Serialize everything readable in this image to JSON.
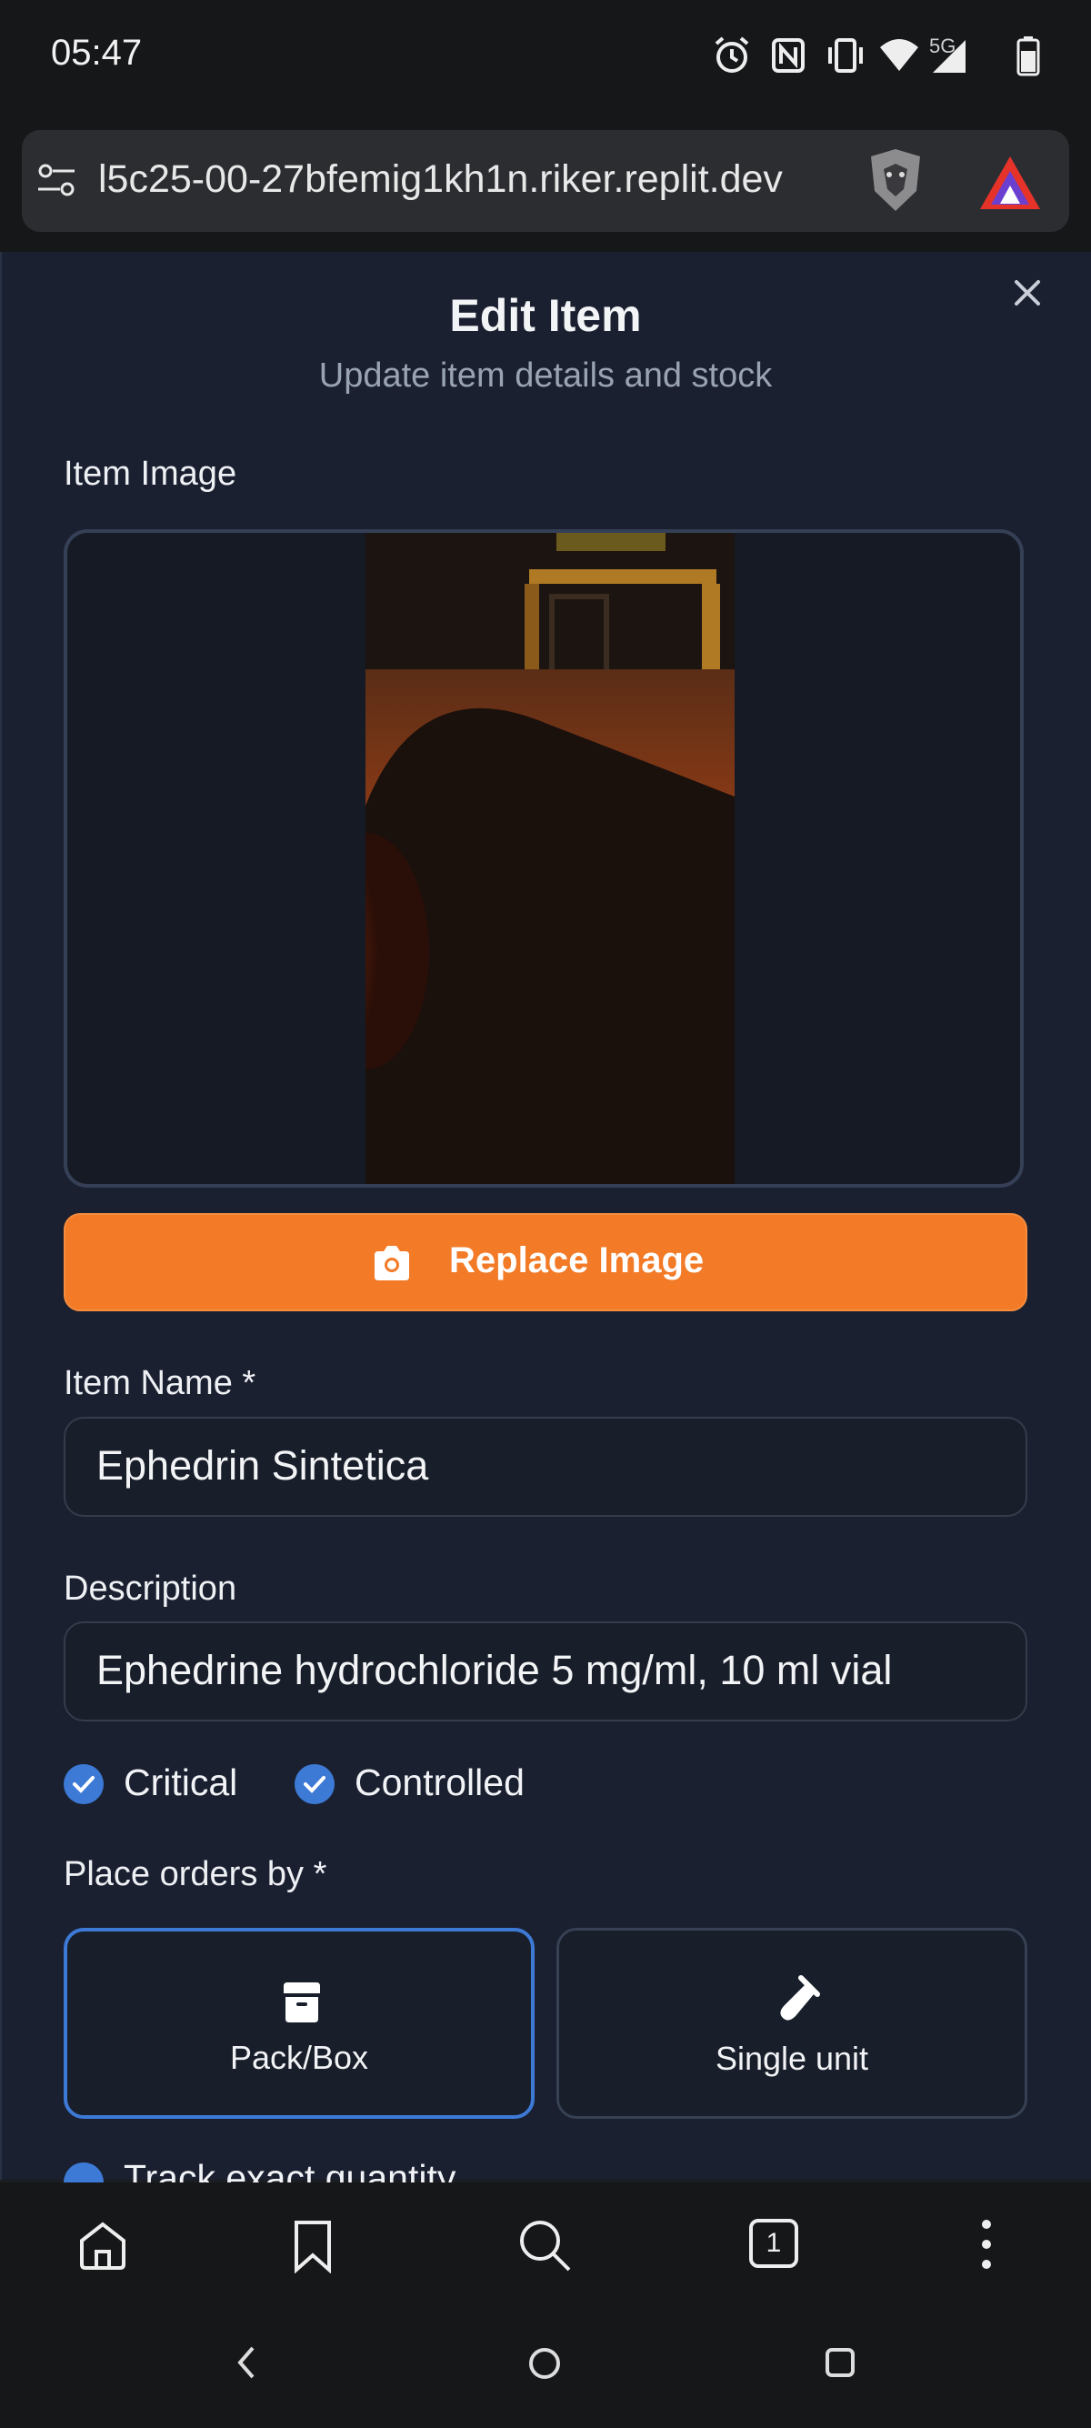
{
  "status": {
    "time": "05:47",
    "network": "5G",
    "icons": [
      "alarm-icon",
      "nfc-icon",
      "vibrate-icon",
      "wifi-icon",
      "signal-icon",
      "battery-icon"
    ]
  },
  "browser": {
    "url": "l5c25-00-27bfemig1kh1n.riker.replit.dev",
    "tab_count": "1"
  },
  "modal": {
    "title": "Edit Item",
    "subtitle": "Update item details and stock",
    "image_label": "Item Image",
    "replace_button": "Replace Image",
    "name_label": "Item Name *",
    "name_value": "Ephedrin Sintetica",
    "description_label": "Description",
    "description_value": "Ephedrine hydrochloride 5 mg/ml, 10 ml vial",
    "checks": [
      {
        "label": "Critical",
        "checked": true
      },
      {
        "label": "Controlled",
        "checked": true
      }
    ],
    "order_label": "Place orders by *",
    "order_options": [
      {
        "label": "Pack/Box",
        "selected": true
      },
      {
        "label": "Single unit",
        "selected": false
      }
    ],
    "track_label": "Track exact quantity"
  },
  "colors": {
    "accent": "#f37a26",
    "selected_border": "#3d7ad6",
    "background": "#1a2030"
  }
}
